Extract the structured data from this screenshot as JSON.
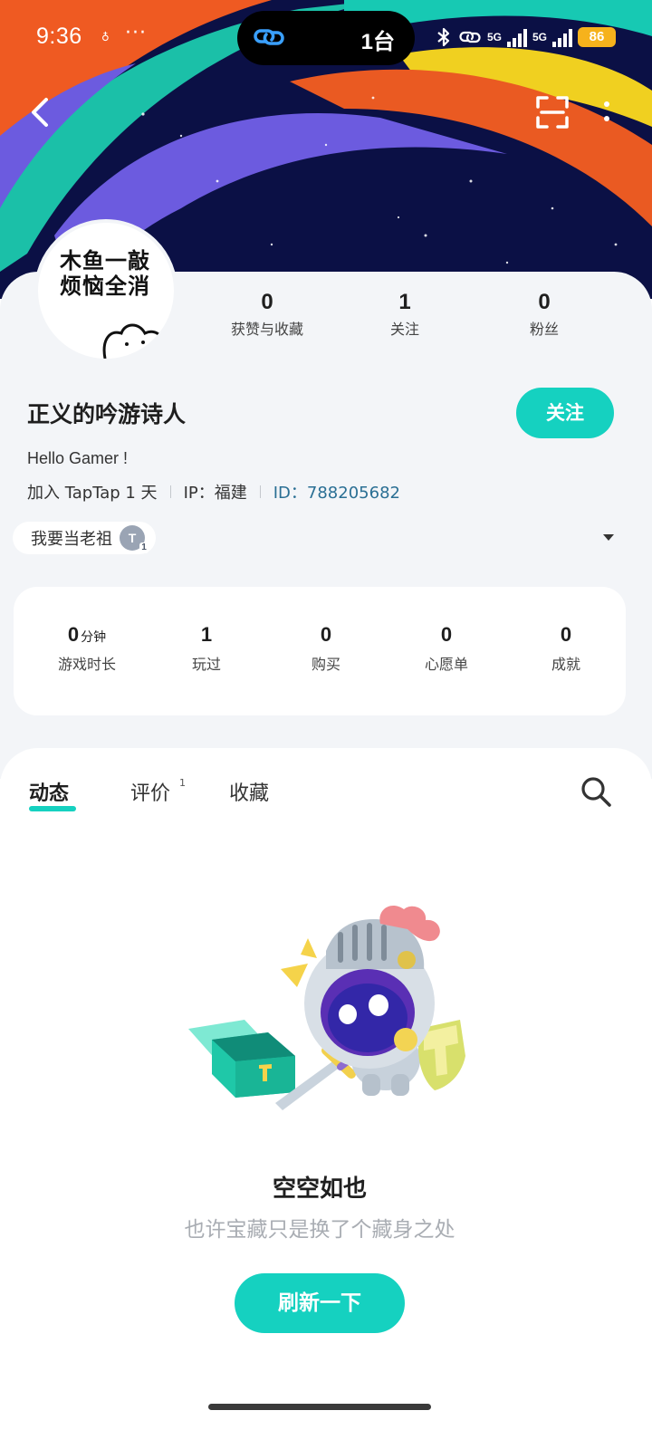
{
  "status_bar": {
    "time": "9:36",
    "overflow": "···",
    "island_text": "1台",
    "net1": "5G",
    "net2": "5G",
    "battery": "86"
  },
  "header": {
    "back_icon": "chevron-left-icon",
    "scan_icon": "scan-icon",
    "more_icon": "more-vertical-icon"
  },
  "profile": {
    "avatar_text_line1": "木鱼一敲",
    "avatar_text_line2": "烦恼全消",
    "counts": [
      {
        "value": "0",
        "label": "获赞与收藏"
      },
      {
        "value": "1",
        "label": "关注"
      },
      {
        "value": "0",
        "label": "粉丝"
      }
    ],
    "username": "正义的吟游诗人",
    "follow_label": "关注",
    "bio": "Hello Gamer !",
    "joined": "加入 TapTap 1 天",
    "ip": "IP：福建",
    "id": "ID：788205682",
    "title_chip": "我要当老祖",
    "title_badge": "T",
    "title_badge_level": "1"
  },
  "stats": [
    {
      "value": "0",
      "unit": "分钟",
      "label": "游戏时长"
    },
    {
      "value": "1",
      "unit": "",
      "label": "玩过"
    },
    {
      "value": "0",
      "unit": "",
      "label": "购买"
    },
    {
      "value": "0",
      "unit": "",
      "label": "心愿单"
    },
    {
      "value": "0",
      "unit": "",
      "label": "成就"
    }
  ],
  "tabs": [
    {
      "label": "动态",
      "active": true
    },
    {
      "label": "评价",
      "badge": "1"
    },
    {
      "label": "收藏"
    }
  ],
  "empty_state": {
    "title": "空空如也",
    "subtitle": "也许宝藏只是换了个藏身之处",
    "refresh_label": "刷新一下"
  },
  "colors": {
    "accent": "#15d1c0",
    "id_link": "#2a6f94",
    "card_bg": "#f3f5f8"
  }
}
